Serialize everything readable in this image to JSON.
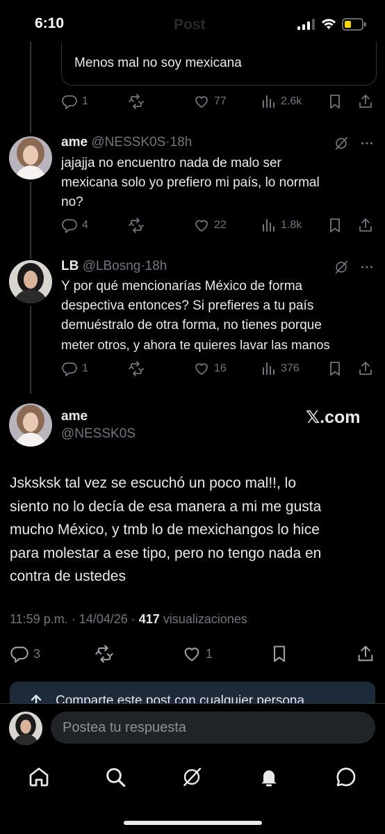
{
  "status_bar": {
    "time": "6:10",
    "title": "Post"
  },
  "quote": {
    "text": "Menos mal no soy mexicana"
  },
  "tweet0_actions": {
    "replies": "1",
    "likes": "77",
    "views": "2.6k"
  },
  "tweets": [
    {
      "name": "ame",
      "handle": "@NESSK0S",
      "time": "·18h",
      "lines": [
        "jajajja no encuentro nada de malo ser",
        "mexicana solo yo prefiero mi país, lo normal",
        "no?"
      ],
      "replies": "4",
      "likes": "22",
      "views": "1.8k"
    },
    {
      "name": "LB",
      "handle": "@LBosng",
      "time": "·18h",
      "lines": [
        "Y por qué mencionarías México de forma",
        "despectiva entonces? Si prefieres a tu país",
        "demuéstralo de otra forma, no tienes porque",
        "meter otros, y ahora te quieres lavar las manos"
      ],
      "replies": "1",
      "likes": "16",
      "views": "376"
    }
  ],
  "main_post": {
    "name": "ame",
    "handle": "@NESSK0S",
    "watermark": "𝕏.com",
    "lines": [
      "Jsksksk tal vez se escuchó un poco mal!!, lo",
      "siento no lo decía de esa manera a mi me gusta",
      "mucho México, y tmb lo de mexichangos lo hice",
      "para molestar a ese tipo, pero no tengo nada en",
      "contra de ustedes"
    ],
    "timestamp": "11:59 p.m. · 14/04/26 · ",
    "views_count": "417",
    "views_label": " visualizaciones",
    "replies": "3",
    "likes": "1"
  },
  "share_banner": {
    "text": "Comparte este post con cualquier persona"
  },
  "reply_bar": {
    "placeholder": "Postea tu respuesta"
  },
  "icons": {
    "reply": "reply-icon",
    "repost": "repost-icon",
    "like": "heart-icon",
    "views": "views-icon",
    "bookmark": "bookmark-icon",
    "share": "share-icon",
    "grok": "grok-icon",
    "more": "more-icon",
    "nav": [
      "home-icon",
      "search-icon",
      "grok-icon",
      "notifications-icon",
      "messages-icon"
    ]
  },
  "colors": {
    "background": "#000000",
    "text": "#e7e9ea",
    "muted": "#71767b",
    "banner": "#1d2a3a",
    "input": "#202327"
  }
}
